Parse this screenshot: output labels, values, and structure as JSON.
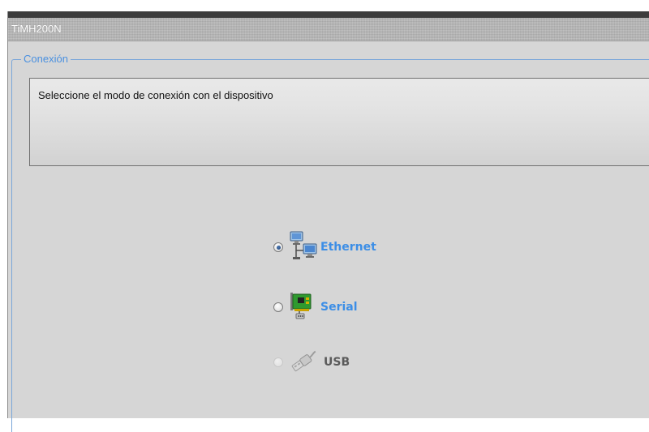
{
  "window": {
    "title": "TiMH200N"
  },
  "group": {
    "legend": "Conexión",
    "description": "Seleccione el modo de conexión con el dispositivo"
  },
  "options": [
    {
      "label": "Ethernet",
      "icon": "network-computers-icon",
      "selected": true,
      "enabled": true,
      "color": "#3c8ee6"
    },
    {
      "label": "Serial",
      "icon": "serial-card-icon",
      "selected": false,
      "enabled": true,
      "color": "#3c8ee6"
    },
    {
      "label": "USB",
      "icon": "usb-cable-icon",
      "selected": false,
      "enabled": false,
      "color": "#5a5a5a"
    }
  ],
  "colors": {
    "accent": "#4a90e0",
    "background": "#d6d6d6"
  }
}
